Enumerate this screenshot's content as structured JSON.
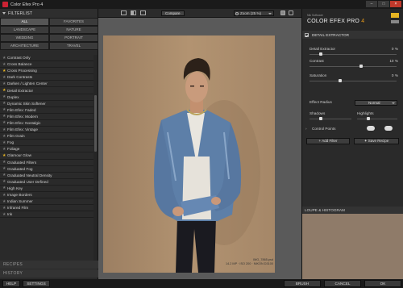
{
  "window": {
    "title": "Color Efex Pro 4",
    "min": "–",
    "max": "□",
    "close": "×"
  },
  "left": {
    "header": "FILTERLIST",
    "categories": [
      {
        "label": "ALL",
        "selected": true
      },
      {
        "label": "FAVORITES",
        "selected": false
      },
      {
        "label": "LANDSCAPE",
        "selected": false
      },
      {
        "label": "NATURE",
        "selected": false
      },
      {
        "label": "WEDDING",
        "selected": false
      },
      {
        "label": "PORTRAIT",
        "selected": false
      },
      {
        "label": "ARCHITECTURE",
        "selected": false
      },
      {
        "label": "TRAVEL",
        "selected": false
      }
    ],
    "filters": [
      {
        "label": "Contrast Only",
        "fav": false
      },
      {
        "label": "Cross Balance",
        "fav": false
      },
      {
        "label": "Cross Processing",
        "fav": true
      },
      {
        "label": "Dark Contrasts",
        "fav": false
      },
      {
        "label": "Darken / Lighten Center",
        "fav": false
      },
      {
        "label": "Detail Extractor",
        "fav": true
      },
      {
        "label": "Duplex",
        "fav": false
      },
      {
        "label": "Dynamic Skin Softener",
        "fav": false
      },
      {
        "label": "Film Efex: Faded",
        "fav": false
      },
      {
        "label": "Film Efex: Modern",
        "fav": false
      },
      {
        "label": "Film Efex: Nostalgic",
        "fav": false
      },
      {
        "label": "Film Efex: Vintage",
        "fav": false
      },
      {
        "label": "Film Grain",
        "fav": false
      },
      {
        "label": "Fog",
        "fav": false
      },
      {
        "label": "Foliage",
        "fav": false
      },
      {
        "label": "Glamour Glow",
        "fav": true
      },
      {
        "label": "Graduated Filters",
        "fav": false
      },
      {
        "label": "Graduated Fog",
        "fav": false
      },
      {
        "label": "Graduated Neutral Density",
        "fav": false
      },
      {
        "label": "Graduated User Defined",
        "fav": false
      },
      {
        "label": "High Key",
        "fav": false
      },
      {
        "label": "Image Borders",
        "fav": false
      },
      {
        "label": "Indian Summer",
        "fav": false
      },
      {
        "label": "Infrared Film",
        "fav": false
      },
      {
        "label": "Ink",
        "fav": false
      }
    ],
    "recipes": "RECIPES",
    "history": "HISTORY"
  },
  "toolbar": {
    "compare": "Compare",
    "zoom": "Zoom (25 %)"
  },
  "image": {
    "filename": "IMG_7865.psd",
    "meta": "14.2 MP · ISO 200 · NIKON D3100"
  },
  "right": {
    "brand_small": "Nik Software",
    "brand": "COLOR EFEX PRO",
    "brand_version": "4",
    "section": "DETAIL EXTRACTOR",
    "params": [
      {
        "label": "Detail Extractor",
        "value": "0 %",
        "level": 0.12
      },
      {
        "label": "Contrast",
        "value": "10 %",
        "level": 0.6
      },
      {
        "label": "Saturation",
        "value": "0 %",
        "level": 0.35
      }
    ],
    "effect_radius_label": "Effect Radius",
    "effect_radius_value": "Normal",
    "shadows": "Shadows",
    "highlights": "Highlights",
    "control_points": "Control Points",
    "add_filter": "Add Filter",
    "save_recipe": "Save Recipe",
    "loupe": "LOUPE & HISTOGRAM"
  },
  "bottom": {
    "help": "HELP",
    "settings": "SETTINGS",
    "brush": "BRUSH",
    "cancel": "CANCEL",
    "ok": "OK"
  },
  "colors": {
    "accent": "#e89a1a",
    "star": "#e6b422"
  }
}
